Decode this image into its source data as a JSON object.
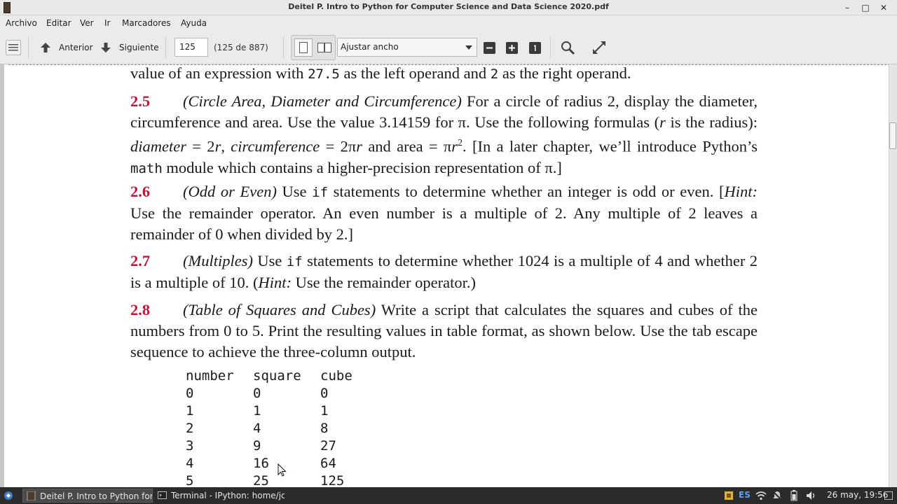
{
  "window": {
    "title": "Deitel P. Intro to Python for Computer Science and Data Science 2020.pdf",
    "controls": [
      "–",
      "□",
      "✕"
    ]
  },
  "menu": [
    "Archivo",
    "Editar",
    "Ver",
    "Ir",
    "Marcadores",
    "Ayuda"
  ],
  "toolbar": {
    "prev_label": "Anterior",
    "next_label": "Siguiente",
    "page_value": "125",
    "page_count": "(125 de 887)",
    "zoom_value": "Ajustar ancho"
  },
  "doc": {
    "line_top_a": "value of an expression with ",
    "line_top_code1": "27.5",
    "line_top_b": " as the left operand and ",
    "line_top_code2": "2",
    "line_top_c": " as the right operand.",
    "ex25": {
      "num": "2.5",
      "title": "(Circle Area, Diameter and Circumference)",
      "t1": " For a circle of radius 2, display the diameter, circumference and area. Use the value 3.14159 for π. Use the following formulas (",
      "r": "r",
      "t2": " is the radius): ",
      "diameter": "diameter",
      "t3": " = 2",
      "r2": "r",
      "t4": ", ",
      "circumference": "circumference",
      "t5": " = 2π",
      "r3": "r",
      "t6": " and area = π",
      "r4": "r",
      "sup": "2",
      "t7": ". [In a later chapter, we’ll introduce Python’s ",
      "code": "math",
      "t8": " module which contains a higher-precision representation of π.]"
    },
    "ex26": {
      "num": "2.6",
      "title": "(Odd or Even)",
      "t1": " Use ",
      "code": "if",
      "t2": " statements to determine whether an integer is odd or even. [",
      "hint": "Hint:",
      "t3": " Use the remainder operator. An even number is a multiple of 2. Any multiple of 2 leaves a remainder of 0 when divided by 2.]"
    },
    "ex27": {
      "num": "2.7",
      "title": "(Multiples)",
      "t1": " Use ",
      "code": "if",
      "t2": " statements to determine whether 1024 is a multiple of 4 and whether 2 is a multiple of 10. (",
      "hint": "Hint:",
      "t3": " Use the remainder operator.)"
    },
    "ex28": {
      "num": "2.8",
      "title": "(Table of Squares and Cubes)",
      "t1": " Write a script that calculates the squares and cubes of the numbers from 0 to 5. Print the resulting values in table format, as shown below. Use the tab escape sequence to achieve the three-column output."
    },
    "table": {
      "headers": [
        "number",
        "square",
        "cube"
      ],
      "rows": [
        [
          "0",
          "0",
          "0"
        ],
        [
          "1",
          "1",
          "1"
        ],
        [
          "2",
          "4",
          "8"
        ],
        [
          "3",
          "9",
          "27"
        ],
        [
          "4",
          "16",
          "64"
        ],
        [
          "5",
          "25",
          "125"
        ]
      ]
    }
  },
  "taskbar": {
    "tasks": [
      "Deitel P. Intro to Python for ...",
      "Terminal - IPython: home/jc..."
    ],
    "lang": "ES",
    "clock": "26 may, 19:56"
  }
}
